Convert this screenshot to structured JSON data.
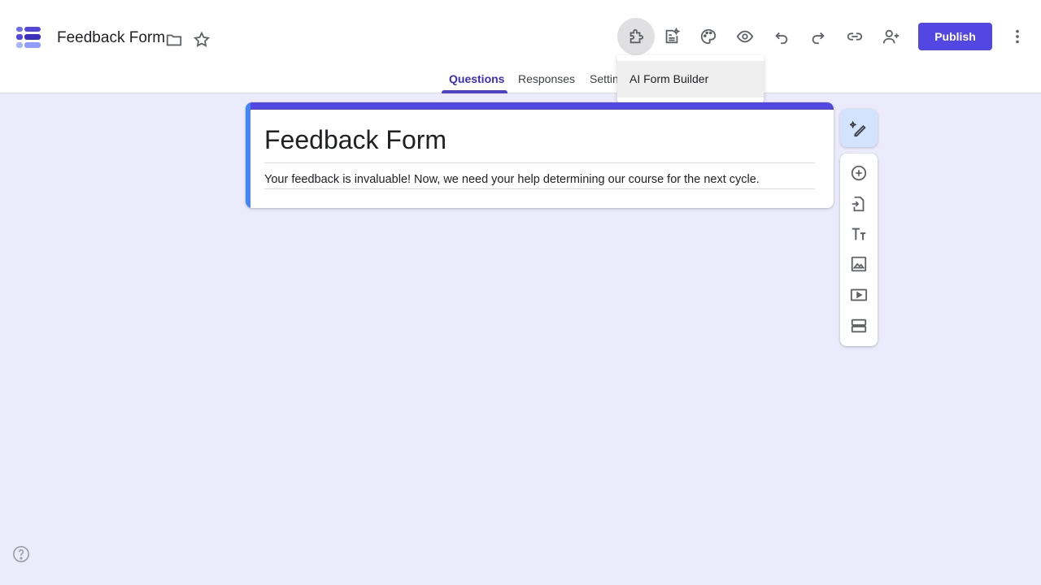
{
  "app": {
    "doc_title": "Feedback Form"
  },
  "toolbar": {
    "publish_label": "Publish",
    "icons": [
      "addons-icon",
      "ai-form-icon",
      "palette-icon",
      "preview-icon",
      "undo-icon",
      "redo-icon",
      "link-icon",
      "add-collaborator-icon"
    ]
  },
  "tabs": [
    {
      "label": "Questions",
      "active": true
    },
    {
      "label": "Responses",
      "active": false
    },
    {
      "label": "Settings",
      "active": false
    }
  ],
  "dropdown": {
    "item": "AI Form Builder"
  },
  "form": {
    "title": "Feedback Form",
    "description": "Your feedback is invaluable! Now, we need your help determining our course for the next cycle."
  },
  "colors": {
    "accent": "#5347e3",
    "card_left_accent": "#4285f4",
    "background": "#ecebfb",
    "side_top_bg": "#d3e3fd"
  }
}
